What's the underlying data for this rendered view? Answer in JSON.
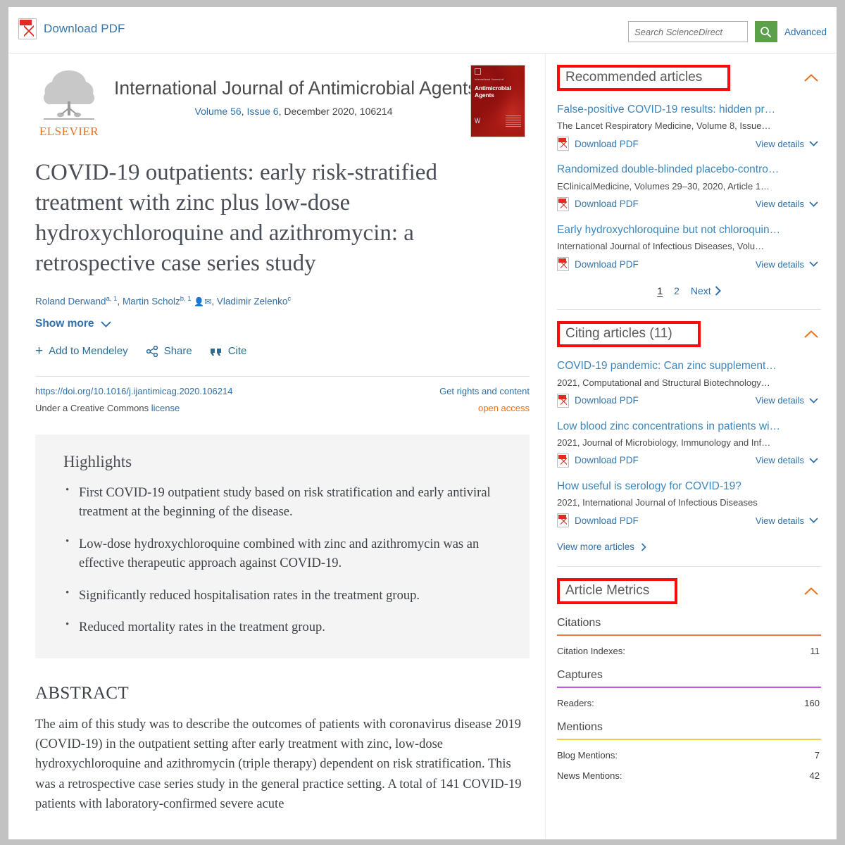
{
  "topbar": {
    "download_pdf": "Download PDF",
    "search_placeholder": "Search ScienceDirect",
    "search_value": "",
    "advanced": "Advanced",
    "search_icon": "search-icon",
    "pdf_icon": "pdf-icon"
  },
  "journal": {
    "publisher": "ELSEVIER",
    "name": "International Journal of Antimicrobial Agents",
    "volume": "Volume 56",
    "issue": "Issue 6",
    "date": "December 2020",
    "article_number": "106214",
    "cover_title": "Antimicrobial Agents",
    "cover_sub": "International Journal of"
  },
  "article": {
    "title": "COVID-19 outpatients: early risk-stratified treatment with zinc plus low-dose hydroxychloroquine and azithromycin: a retrospective case series study",
    "authors": [
      {
        "name": "Roland Derwand",
        "sup": "a, 1",
        "icons": []
      },
      {
        "name": "Martin Scholz",
        "sup": "b, 1",
        "icons": [
          "person-icon",
          "envelope-icon"
        ]
      },
      {
        "name": "Vladimir Zelenko",
        "sup": "c",
        "icons": []
      }
    ],
    "show_more": "Show more",
    "actions": [
      {
        "label": "Add to Mendeley",
        "icon": "plus-icon"
      },
      {
        "label": "Share",
        "icon": "share-icon"
      },
      {
        "label": "Cite",
        "icon": "quote-icon"
      }
    ],
    "doi": "https://doi.org/10.1016/j.ijantimicag.2020.106214",
    "rights": "Get rights and content",
    "license_prefix": "Under a Creative Commons",
    "license_link": "license",
    "open_access": "open access"
  },
  "highlights": {
    "heading": "Highlights",
    "items": [
      "First COVID-19 outpatient study based on risk stratification and early antiviral treatment at the beginning of the disease.",
      "Low-dose hydroxychloroquine combined with zinc and azithromycin was an effective therapeutic approach against COVID-19.",
      "Significantly reduced hospitalisation rates in the treatment group.",
      "Reduced mortality rates in the treatment group."
    ]
  },
  "abstract": {
    "heading": "ABSTRACT",
    "text": "The aim of this study was to describe the outcomes of patients with coronavirus disease 2019 (COVID-19) in the outpatient setting after early treatment with zinc, low-dose hydroxychloroquine and azithromycin (triple therapy) dependent on risk stratification. This was a retrospective case series study in the general practice setting. A total of 141 COVID-19 patients with laboratory-confirmed severe acute"
  },
  "sidebar": {
    "recommended": {
      "title": "Recommended articles",
      "toggle_icon": "chevron-up-icon",
      "items": [
        {
          "title": "False-positive COVID-19 results: hidden pr…",
          "meta": "The Lancet Respiratory Medicine, Volume 8, Issue…",
          "download": "Download PDF",
          "view_details": "View details"
        },
        {
          "title": "Randomized double-blinded placebo-contro…",
          "meta": "EClinicalMedicine, Volumes 29–30, 2020, Article 1…",
          "download": "Download PDF",
          "view_details": "View details"
        },
        {
          "title": "Early hydroxychloroquine but not chloroquin…",
          "meta": "International Journal of Infectious Diseases, Volu…",
          "download": "Download PDF",
          "view_details": "View details"
        }
      ],
      "pager": {
        "pages": [
          "1",
          "2"
        ],
        "current": "1",
        "next": "Next"
      }
    },
    "citing": {
      "title": "Citing articles (11)",
      "toggle_icon": "chevron-up-icon",
      "items": [
        {
          "title": "COVID-19 pandemic: Can zinc supplement…",
          "meta": "2021, Computational and Structural Biotechnology…",
          "download": "Download PDF",
          "view_details": "View details"
        },
        {
          "title": "Low blood zinc concentrations in patients wi…",
          "meta": "2021, Journal of Microbiology, Immunology and Inf…",
          "download": "Download PDF",
          "view_details": "View details"
        },
        {
          "title": "How useful is serology for COVID-19?",
          "meta": "2021, International Journal of Infectious Diseases",
          "download": "Download PDF",
          "view_details": "View details"
        }
      ],
      "view_more": "View more articles"
    },
    "metrics": {
      "title": "Article Metrics",
      "toggle_icon": "chevron-up-icon",
      "groups": [
        {
          "label": "Citations",
          "rule_color": "#f0774a",
          "rows": [
            {
              "label": "Citation Indexes:",
              "value": "11"
            }
          ]
        },
        {
          "label": "Captures",
          "rule_color": "#c455e8",
          "rows": [
            {
              "label": "Readers:",
              "value": "160"
            }
          ]
        },
        {
          "label": "Mentions",
          "rule_color": "#f2c94c",
          "rows": [
            {
              "label": "Blog Mentions:",
              "value": "7"
            },
            {
              "label": "News Mentions:",
              "value": "42"
            }
          ]
        }
      ]
    }
  },
  "colors": {
    "link": "#2f6fa8",
    "accent_orange": "#e9711c",
    "annotation_red": "#f70b0b",
    "search_green": "#5aa14a"
  }
}
